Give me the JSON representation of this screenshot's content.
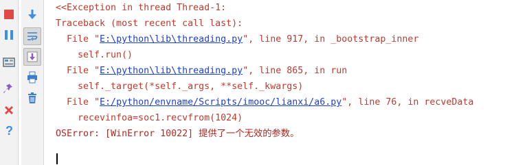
{
  "console": {
    "lines": [
      {
        "text": "<<Exception in thread Thread-1:"
      },
      {
        "text": "Traceback (most recent call last):"
      },
      {
        "prefix": "File \"",
        "link": "E:\\python\\lib\\threading.py",
        "suffix": "\", line 917, in _bootstrap_inner"
      },
      {
        "text": "self.run()"
      },
      {
        "prefix": "File \"",
        "link": "E:\\python\\lib\\threading.py",
        "suffix": "\", line 865, in run"
      },
      {
        "text": "self._target(*self._args, **self._kwargs)"
      },
      {
        "prefix": "File \"",
        "link": "E:/python/envname/Scripts/imooc/lianxi/a6.py",
        "suffix": "\", line 76, in recveData"
      },
      {
        "text": "recevinfoa=soc1.recvfrom(1024)"
      },
      {
        "text": "OSError: [WinError 10022] 提供了一个无效的参数。"
      }
    ]
  },
  "left_toolbar": {
    "buttons": [
      "stop-icon",
      "pause-icon",
      "layout-icon",
      "pin-icon",
      "close-icon",
      "help-icon"
    ]
  },
  "mid_toolbar": {
    "buttons": [
      "scroll-down-icon",
      "soft-wrap-icon",
      "scroll-to-end-icon",
      "print-icon",
      "trash-icon"
    ]
  },
  "colors": {
    "error_text": "#b3261e",
    "link": "#1a3fd6",
    "toolbar_bg": "#f2f2f2"
  }
}
